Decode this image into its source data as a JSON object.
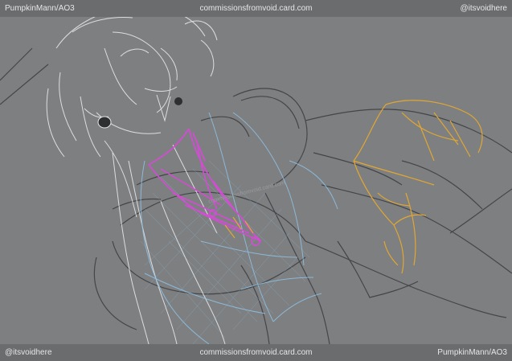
{
  "top_bar": {
    "left": "PumpkinMann/AO3",
    "center": "commissionsfromvoid.card.com",
    "right": "@itsvoidhere"
  },
  "bottom_bar": {
    "left": "@itsvoidhere",
    "center": "commissionsfromvoid.card.com",
    "right": "PumpkinMann/AO3"
  },
  "colors": {
    "background": "#7e7f81",
    "bar": "#6b6c6e",
    "sketch_white": "#e8e8ea",
    "sketch_dark": "#3b3c3f",
    "sketch_blue": "#8fc3e6",
    "sketch_magenta": "#d64ad8",
    "sketch_orange": "#e0a733"
  }
}
